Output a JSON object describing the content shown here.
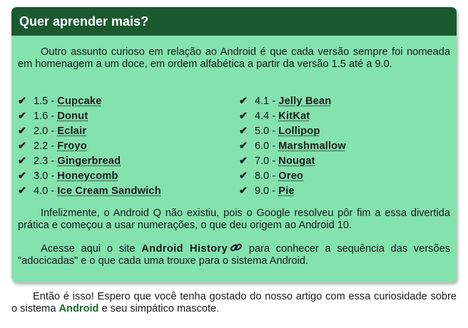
{
  "box": {
    "title": "Quer aprender mais?",
    "intro": "Outro assunto curioso em relação ao Android é que cada versão sempre foi nomeada em homenagem a um doce, em ordem alfabética a partir da versão 1.5 até a 9.0.",
    "versions_left": [
      {
        "version": "1.5",
        "name": "Cupcake"
      },
      {
        "version": "1.6",
        "name": "Donut"
      },
      {
        "version": "2.0",
        "name": "Eclair"
      },
      {
        "version": "2.2",
        "name": "Froyo"
      },
      {
        "version": "2.3",
        "name": "Gingerbread"
      },
      {
        "version": "3.0",
        "name": "Honeycomb"
      },
      {
        "version": "4.0",
        "name": "Ice Cream Sandwich"
      }
    ],
    "versions_right": [
      {
        "version": "4.1",
        "name": "Jelly Bean"
      },
      {
        "version": "4.4",
        "name": "KitKat"
      },
      {
        "version": "5.0",
        "name": "Lollipop"
      },
      {
        "version": "6.0",
        "name": "Marshmallow"
      },
      {
        "version": "7.0",
        "name": "Nougat"
      },
      {
        "version": "8.0",
        "name": "Oreo"
      },
      {
        "version": "9.0",
        "name": "Pie"
      }
    ],
    "check_symbol": "✔",
    "separator": " - ",
    "paragraph_q": "Infelizmente, o Android Q não existiu, pois o Google resolveu pôr fim a essa divertida prática e começou a usar numerações, o que deu origem ao Android 10.",
    "paragraph_site": {
      "before": "Acesse aqui o site ",
      "link": "Android History",
      "after": " para conhecer a sequência das versões \"adocicadas\" e o que cada uma trouxe para o sistema Android.",
      "link_icon": "chain-link-icon"
    }
  },
  "footer": {
    "before": "Então é isso! Espero que você tenha gostado do nosso artigo com essa curiosidade sobre o sistema ",
    "highlight": "Android",
    "after": " e seu simpático mascote."
  },
  "colors": {
    "box_background": "#84e2ae",
    "header_background": "#1b5a31",
    "header_text": "#ffffff",
    "highlight_green": "#1b6a2f"
  }
}
